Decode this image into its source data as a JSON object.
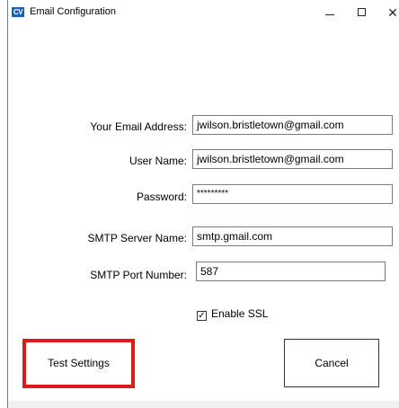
{
  "window": {
    "title": "Email Configuration",
    "app_icon_text": "CV",
    "controls": {
      "minimize": "—",
      "maximize": "☐",
      "close": "✕"
    }
  },
  "form": {
    "email": {
      "label": "Your Email Address:",
      "value": "jwilson.bristletown@gmail.com"
    },
    "username": {
      "label": "User Name:",
      "value": "jwilson.bristletown@gmail.com"
    },
    "password": {
      "label": "Password:",
      "value": "*********"
    },
    "smtp_server": {
      "label": "SMTP Server Name:",
      "value": "smtp.gmail.com"
    },
    "smtp_port": {
      "label": "SMTP Port Number:",
      "value": "587"
    },
    "enable_ssl": {
      "label": "Enable SSL",
      "checked": true,
      "check_glyph": "✓"
    }
  },
  "buttons": {
    "test_settings": "Test Settings",
    "cancel": "Cancel"
  },
  "colors": {
    "highlight": "#e01919",
    "app_icon": "#1f5fb0"
  }
}
